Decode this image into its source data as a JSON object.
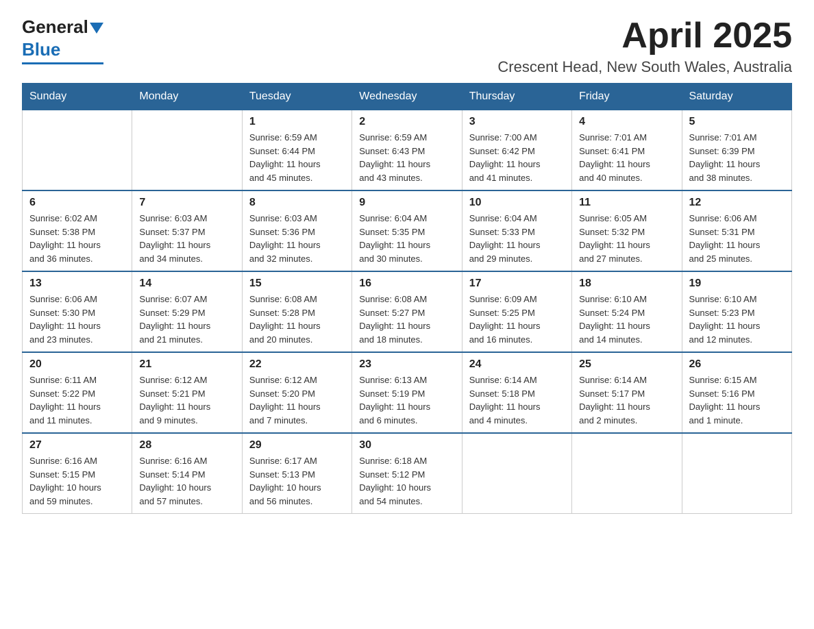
{
  "header": {
    "logo_general": "General",
    "logo_blue": "Blue",
    "month_title": "April 2025",
    "location": "Crescent Head, New South Wales, Australia"
  },
  "days_of_week": [
    "Sunday",
    "Monday",
    "Tuesday",
    "Wednesday",
    "Thursday",
    "Friday",
    "Saturday"
  ],
  "weeks": [
    [
      {
        "day": "",
        "info": ""
      },
      {
        "day": "",
        "info": ""
      },
      {
        "day": "1",
        "info": "Sunrise: 6:59 AM\nSunset: 6:44 PM\nDaylight: 11 hours\nand 45 minutes."
      },
      {
        "day": "2",
        "info": "Sunrise: 6:59 AM\nSunset: 6:43 PM\nDaylight: 11 hours\nand 43 minutes."
      },
      {
        "day": "3",
        "info": "Sunrise: 7:00 AM\nSunset: 6:42 PM\nDaylight: 11 hours\nand 41 minutes."
      },
      {
        "day": "4",
        "info": "Sunrise: 7:01 AM\nSunset: 6:41 PM\nDaylight: 11 hours\nand 40 minutes."
      },
      {
        "day": "5",
        "info": "Sunrise: 7:01 AM\nSunset: 6:39 PM\nDaylight: 11 hours\nand 38 minutes."
      }
    ],
    [
      {
        "day": "6",
        "info": "Sunrise: 6:02 AM\nSunset: 5:38 PM\nDaylight: 11 hours\nand 36 minutes."
      },
      {
        "day": "7",
        "info": "Sunrise: 6:03 AM\nSunset: 5:37 PM\nDaylight: 11 hours\nand 34 minutes."
      },
      {
        "day": "8",
        "info": "Sunrise: 6:03 AM\nSunset: 5:36 PM\nDaylight: 11 hours\nand 32 minutes."
      },
      {
        "day": "9",
        "info": "Sunrise: 6:04 AM\nSunset: 5:35 PM\nDaylight: 11 hours\nand 30 minutes."
      },
      {
        "day": "10",
        "info": "Sunrise: 6:04 AM\nSunset: 5:33 PM\nDaylight: 11 hours\nand 29 minutes."
      },
      {
        "day": "11",
        "info": "Sunrise: 6:05 AM\nSunset: 5:32 PM\nDaylight: 11 hours\nand 27 minutes."
      },
      {
        "day": "12",
        "info": "Sunrise: 6:06 AM\nSunset: 5:31 PM\nDaylight: 11 hours\nand 25 minutes."
      }
    ],
    [
      {
        "day": "13",
        "info": "Sunrise: 6:06 AM\nSunset: 5:30 PM\nDaylight: 11 hours\nand 23 minutes."
      },
      {
        "day": "14",
        "info": "Sunrise: 6:07 AM\nSunset: 5:29 PM\nDaylight: 11 hours\nand 21 minutes."
      },
      {
        "day": "15",
        "info": "Sunrise: 6:08 AM\nSunset: 5:28 PM\nDaylight: 11 hours\nand 20 minutes."
      },
      {
        "day": "16",
        "info": "Sunrise: 6:08 AM\nSunset: 5:27 PM\nDaylight: 11 hours\nand 18 minutes."
      },
      {
        "day": "17",
        "info": "Sunrise: 6:09 AM\nSunset: 5:25 PM\nDaylight: 11 hours\nand 16 minutes."
      },
      {
        "day": "18",
        "info": "Sunrise: 6:10 AM\nSunset: 5:24 PM\nDaylight: 11 hours\nand 14 minutes."
      },
      {
        "day": "19",
        "info": "Sunrise: 6:10 AM\nSunset: 5:23 PM\nDaylight: 11 hours\nand 12 minutes."
      }
    ],
    [
      {
        "day": "20",
        "info": "Sunrise: 6:11 AM\nSunset: 5:22 PM\nDaylight: 11 hours\nand 11 minutes."
      },
      {
        "day": "21",
        "info": "Sunrise: 6:12 AM\nSunset: 5:21 PM\nDaylight: 11 hours\nand 9 minutes."
      },
      {
        "day": "22",
        "info": "Sunrise: 6:12 AM\nSunset: 5:20 PM\nDaylight: 11 hours\nand 7 minutes."
      },
      {
        "day": "23",
        "info": "Sunrise: 6:13 AM\nSunset: 5:19 PM\nDaylight: 11 hours\nand 6 minutes."
      },
      {
        "day": "24",
        "info": "Sunrise: 6:14 AM\nSunset: 5:18 PM\nDaylight: 11 hours\nand 4 minutes."
      },
      {
        "day": "25",
        "info": "Sunrise: 6:14 AM\nSunset: 5:17 PM\nDaylight: 11 hours\nand 2 minutes."
      },
      {
        "day": "26",
        "info": "Sunrise: 6:15 AM\nSunset: 5:16 PM\nDaylight: 11 hours\nand 1 minute."
      }
    ],
    [
      {
        "day": "27",
        "info": "Sunrise: 6:16 AM\nSunset: 5:15 PM\nDaylight: 10 hours\nand 59 minutes."
      },
      {
        "day": "28",
        "info": "Sunrise: 6:16 AM\nSunset: 5:14 PM\nDaylight: 10 hours\nand 57 minutes."
      },
      {
        "day": "29",
        "info": "Sunrise: 6:17 AM\nSunset: 5:13 PM\nDaylight: 10 hours\nand 56 minutes."
      },
      {
        "day": "30",
        "info": "Sunrise: 6:18 AM\nSunset: 5:12 PM\nDaylight: 10 hours\nand 54 minutes."
      },
      {
        "day": "",
        "info": ""
      },
      {
        "day": "",
        "info": ""
      },
      {
        "day": "",
        "info": ""
      }
    ]
  ]
}
